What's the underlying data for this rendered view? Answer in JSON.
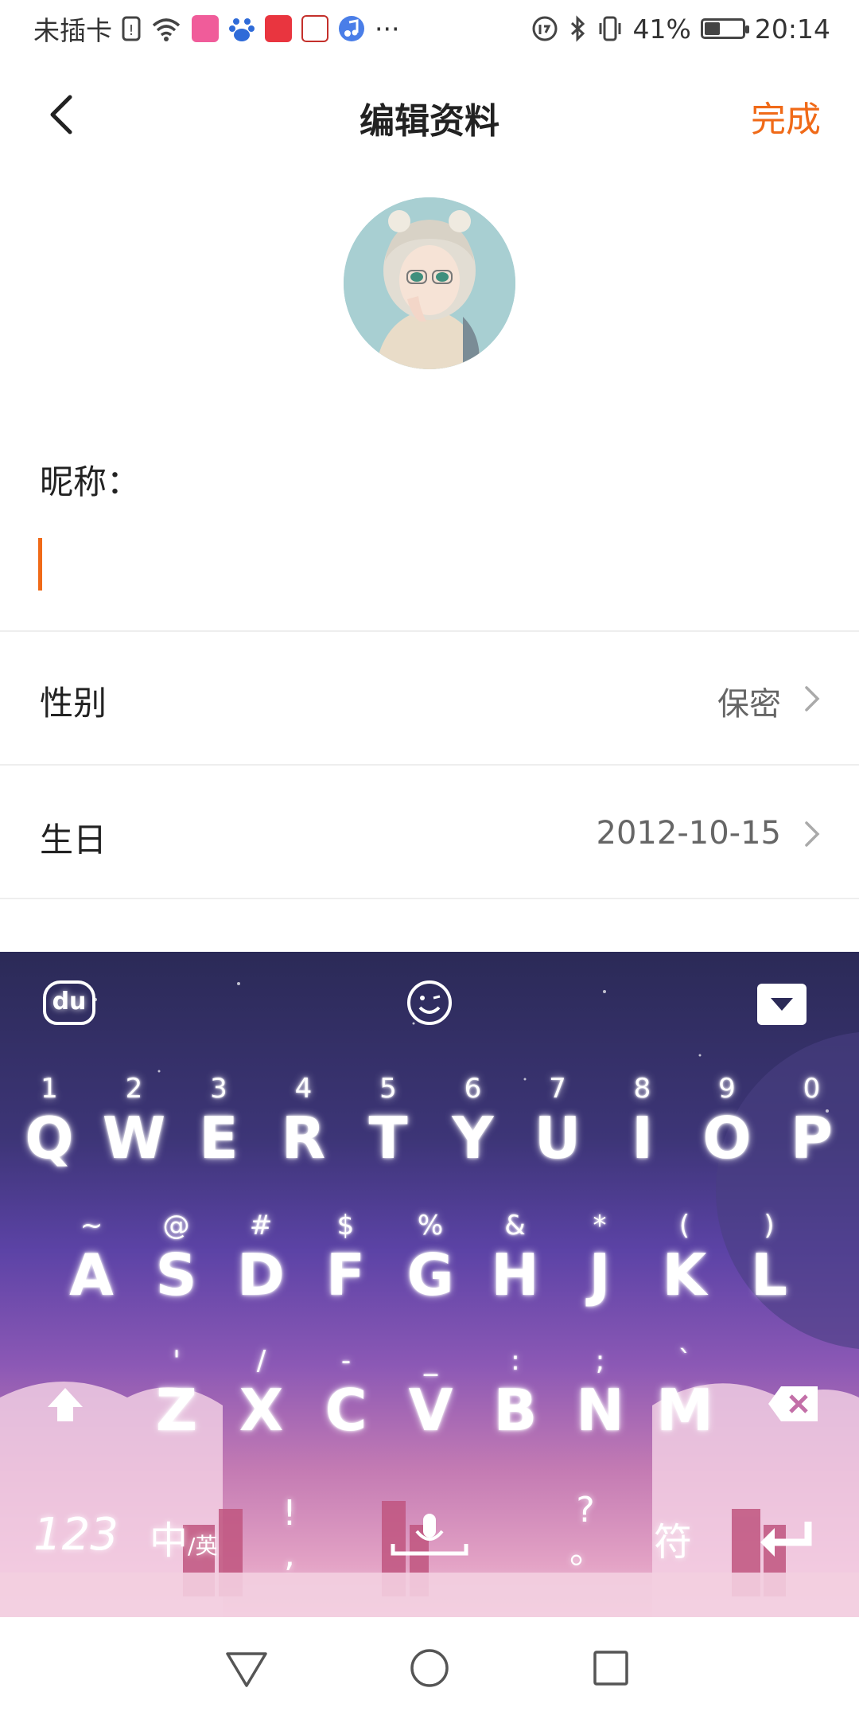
{
  "status_bar": {
    "carrier": "未插卡",
    "more": "···",
    "battery": "41%",
    "battery_level": 0.41,
    "time": "20:14"
  },
  "header": {
    "title": "编辑资料",
    "done_label": "完成",
    "accent_color": "#f06a18"
  },
  "profile": {
    "nickname_label": "昵称：",
    "nickname_value": "",
    "rows": [
      {
        "label": "性别",
        "value": "保密"
      },
      {
        "label": "生日",
        "value": "2012-10-15"
      }
    ]
  },
  "keyboard": {
    "row1": [
      {
        "hint": "1",
        "key": "Q"
      },
      {
        "hint": "2",
        "key": "W"
      },
      {
        "hint": "3",
        "key": "E"
      },
      {
        "hint": "4",
        "key": "R"
      },
      {
        "hint": "5",
        "key": "T"
      },
      {
        "hint": "6",
        "key": "Y"
      },
      {
        "hint": "7",
        "key": "U"
      },
      {
        "hint": "8",
        "key": "I"
      },
      {
        "hint": "9",
        "key": "O"
      },
      {
        "hint": "0",
        "key": "P"
      }
    ],
    "row2": [
      {
        "hint": "~",
        "key": "A"
      },
      {
        "hint": "@",
        "key": "S"
      },
      {
        "hint": "#",
        "key": "D"
      },
      {
        "hint": "$",
        "key": "F"
      },
      {
        "hint": "%",
        "key": "G"
      },
      {
        "hint": "&",
        "key": "H"
      },
      {
        "hint": "*",
        "key": "J"
      },
      {
        "hint": "(",
        "key": "K"
      },
      {
        "hint": ")",
        "key": "L"
      }
    ],
    "row3": [
      {
        "hint": "'",
        "key": "Z"
      },
      {
        "hint": "/",
        "key": "X"
      },
      {
        "hint": "-",
        "key": "C"
      },
      {
        "hint": "_",
        "key": "V"
      },
      {
        "hint": ":",
        "key": "B"
      },
      {
        "hint": ";",
        "key": "N"
      },
      {
        "hint": "`",
        "key": "M"
      }
    ],
    "toolbar": {
      "logo": "du"
    },
    "bottom": {
      "numbers": "123",
      "lang_main": "中",
      "lang_sub": "/英",
      "punct_top": "!",
      "punct_bottom": ",",
      "question_top": "?",
      "question_bottom": "。",
      "symbols": "符"
    }
  }
}
